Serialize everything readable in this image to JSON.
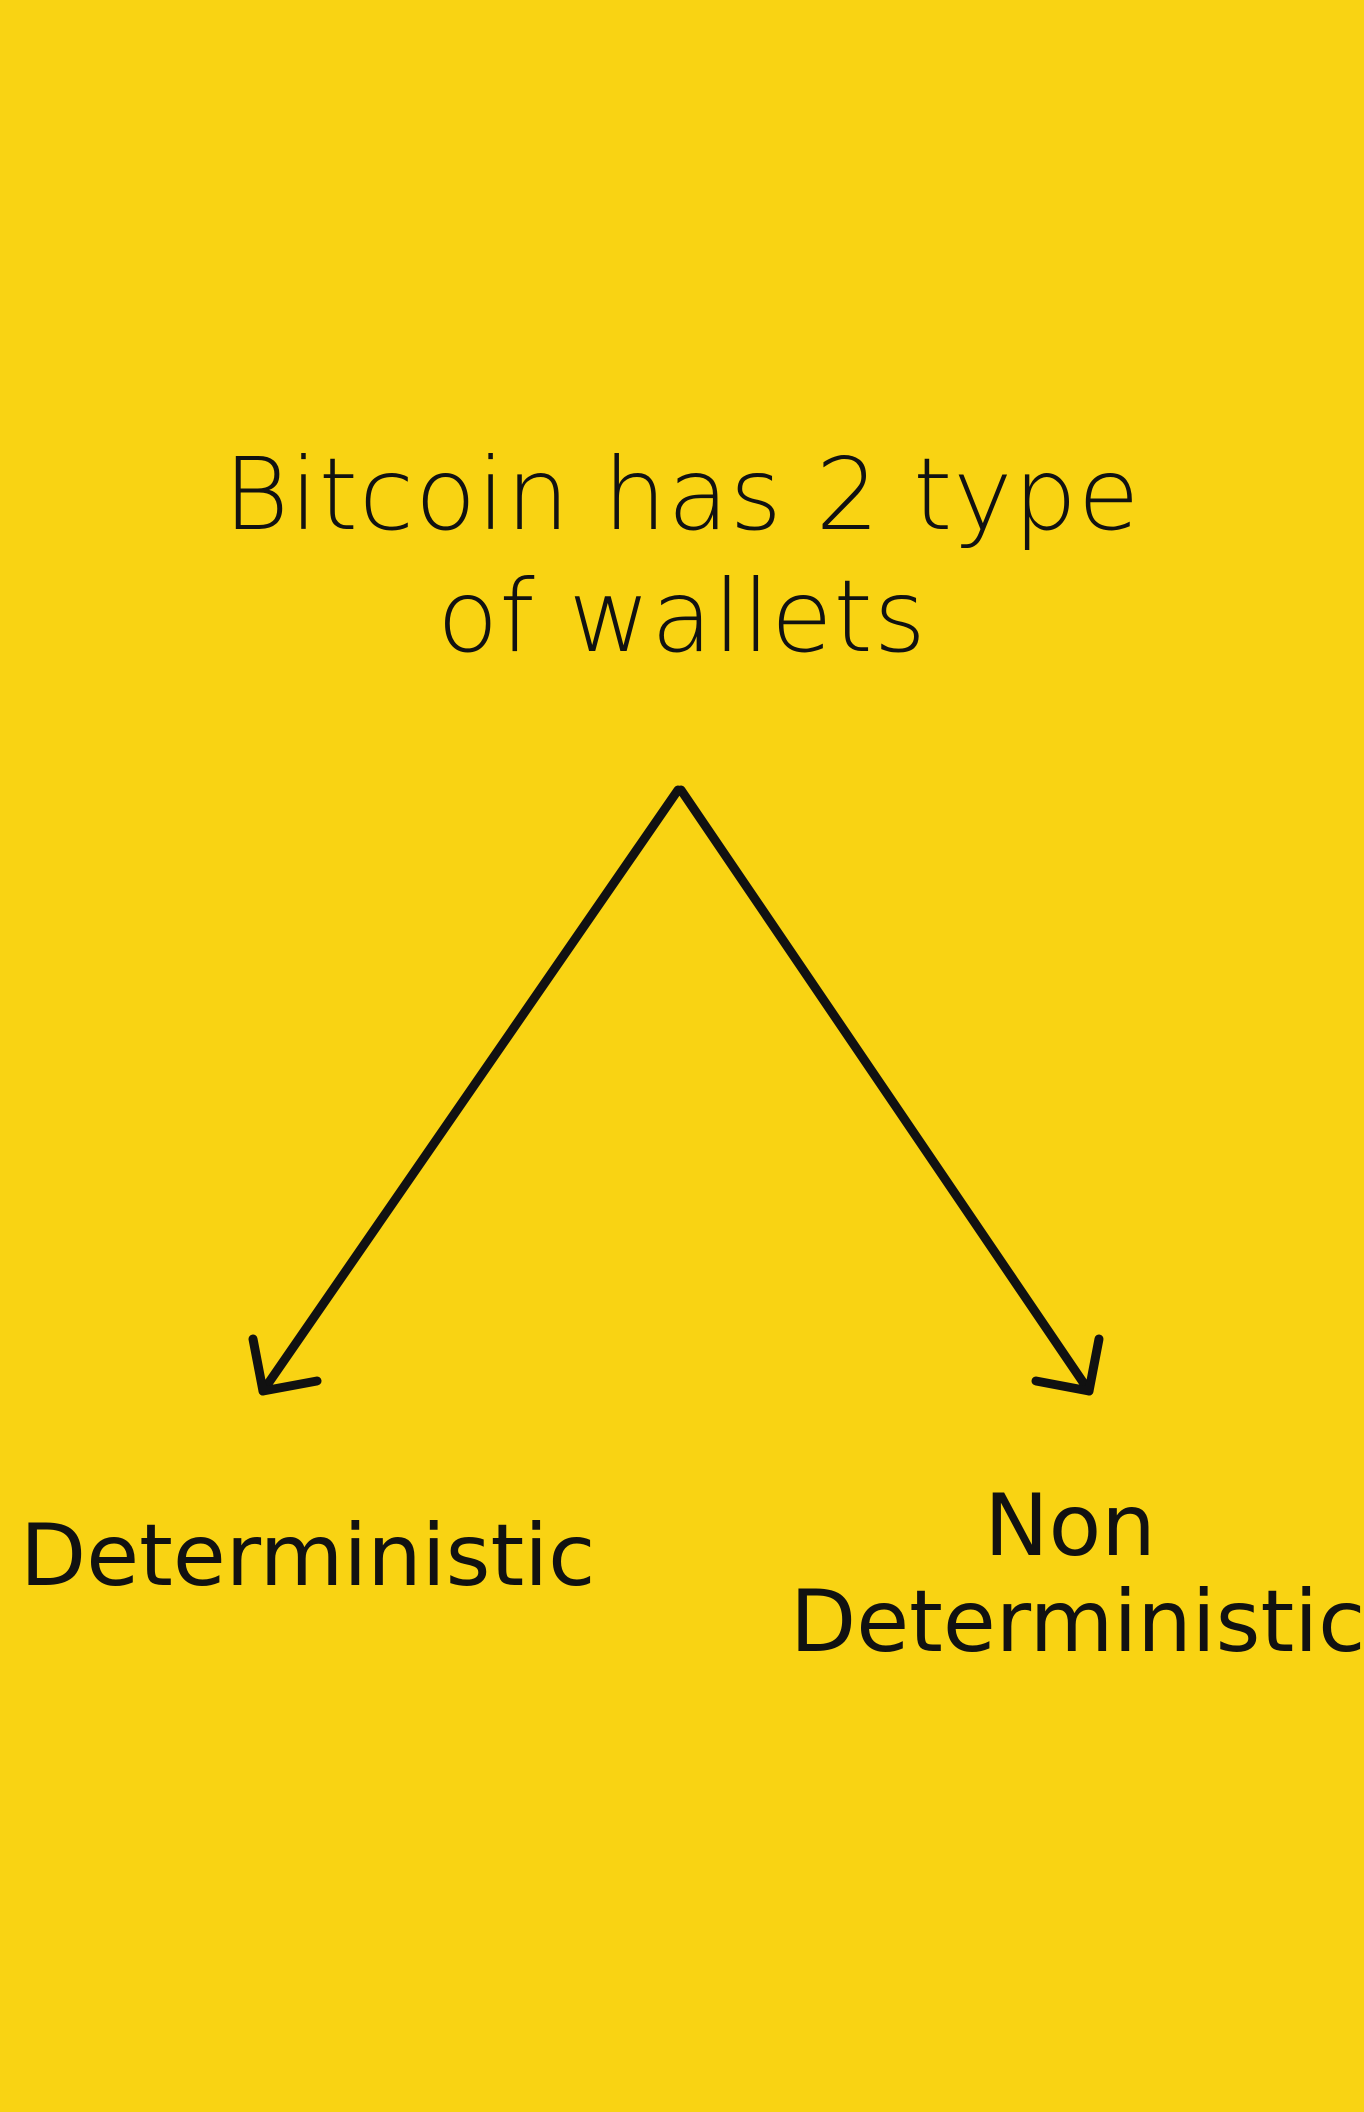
{
  "title": {
    "line1": "Bitcoin has 2 type",
    "line2": "of wallets"
  },
  "branches": [
    {
      "lines": [
        "Deterministic"
      ]
    },
    {
      "lines": [
        "Non",
        "Deterministic"
      ]
    }
  ],
  "colors": {
    "background": "#F9D313",
    "ink": "#111111"
  }
}
